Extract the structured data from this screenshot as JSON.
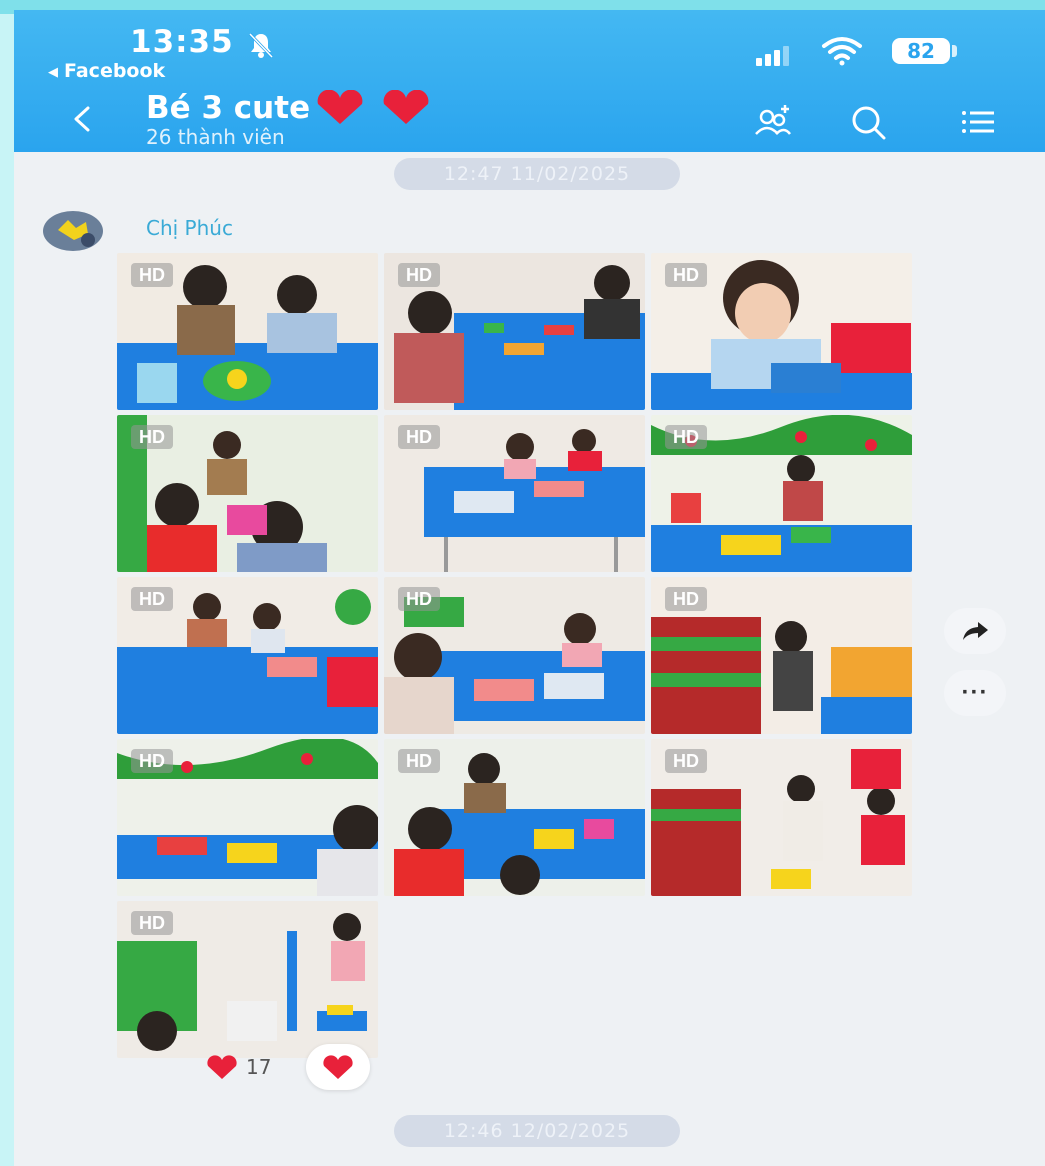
{
  "status_bar": {
    "time": "13:35",
    "back_app_label": "Facebook",
    "battery": "82"
  },
  "chat_header": {
    "title": "Bé 3 cute",
    "members": "26 thành viên"
  },
  "messages": {
    "timestamp_1": "12:47 11/02/2025",
    "sender": "Chị Phúc",
    "hd_label": "HD",
    "reaction_count": "17",
    "timestamp_2": "12:46 12/02/2025"
  },
  "colors": {
    "header": "#2aa4ee",
    "heart": "#e8213a",
    "table_blue": "#1f7fe0",
    "page_bg": "#c8f4f6"
  },
  "icons": [
    "bell-muted-icon",
    "signal-icon",
    "wifi-icon",
    "back-chevron-icon",
    "add-member-icon",
    "search-icon",
    "menu-icon",
    "share-icon",
    "more-icon",
    "heart-icon"
  ]
}
